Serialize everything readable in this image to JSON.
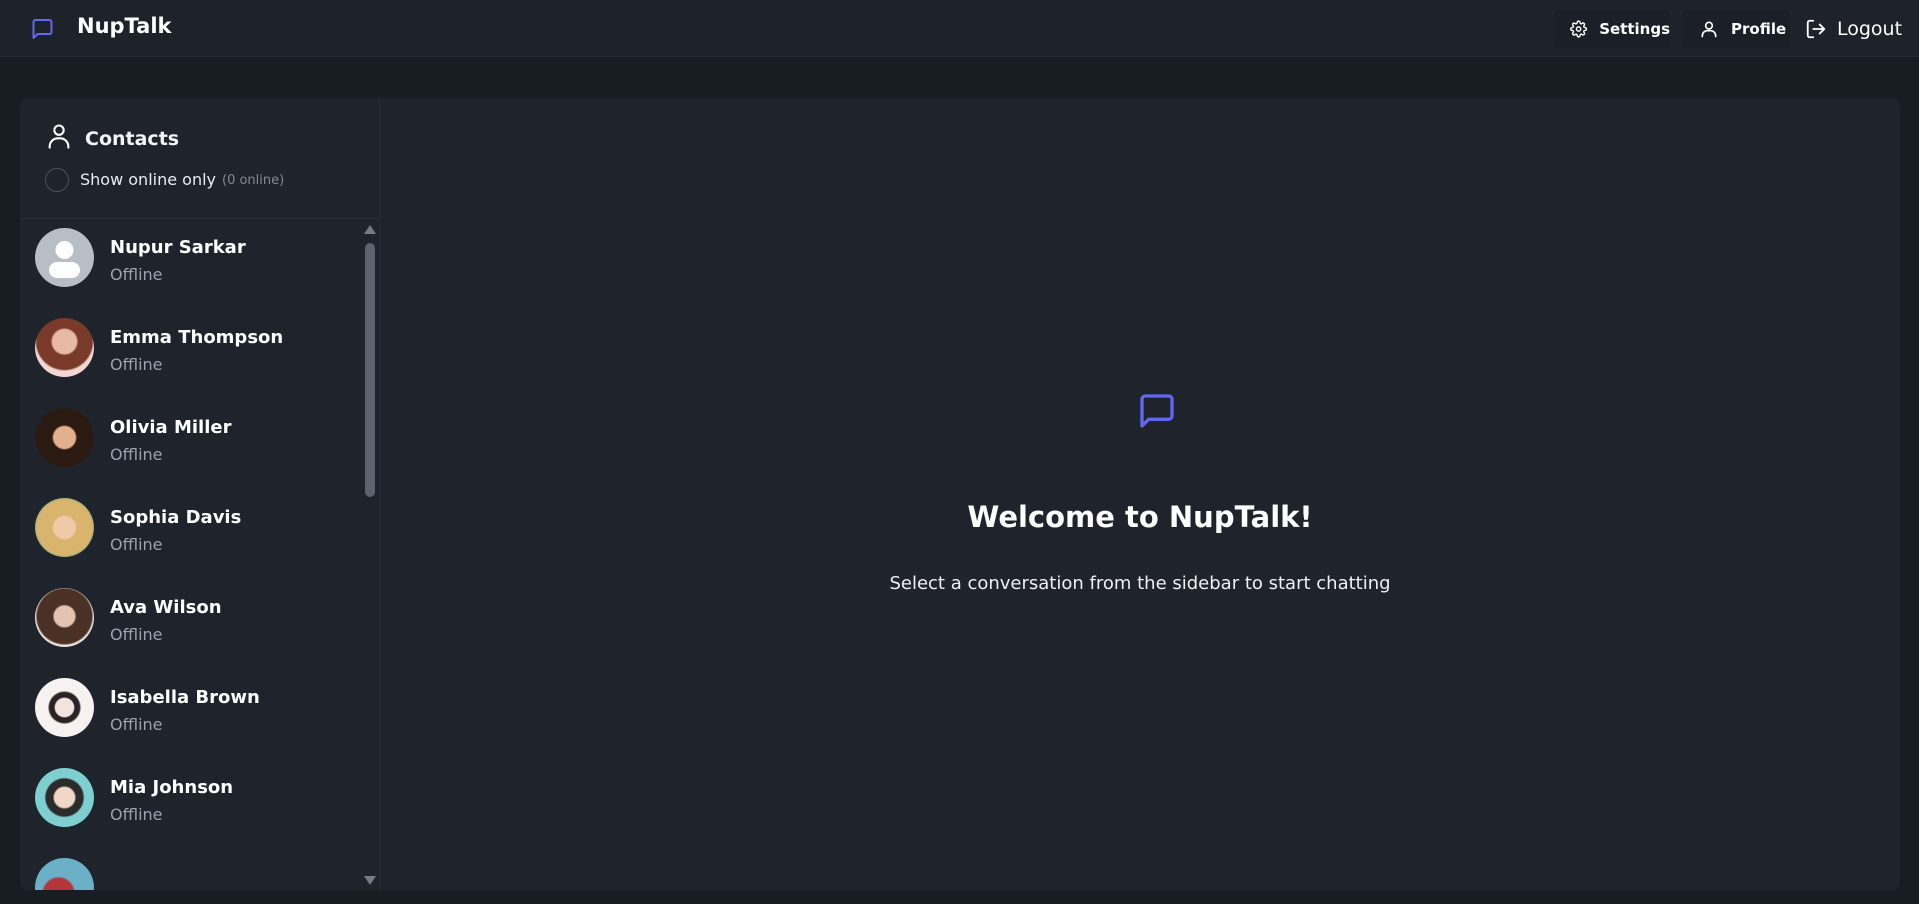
{
  "app": {
    "name": "NupTalk",
    "accent_color": "#6366f1"
  },
  "nav": {
    "settings_label": "Settings",
    "profile_label": "Profile",
    "logout_label": "Logout"
  },
  "sidebar": {
    "title": "Contacts",
    "filter_label": "Show online only",
    "online_count": "(0 online)",
    "filter_checked": false,
    "contacts": [
      {
        "name": "Nupur Sarkar",
        "status": "Offline",
        "avatar": "default-avatar"
      },
      {
        "name": "Emma Thompson",
        "status": "Offline",
        "avatar": "photo"
      },
      {
        "name": "Olivia Miller",
        "status": "Offline",
        "avatar": "photo"
      },
      {
        "name": "Sophia Davis",
        "status": "Offline",
        "avatar": "photo"
      },
      {
        "name": "Ava Wilson",
        "status": "Offline",
        "avatar": "photo"
      },
      {
        "name": "Isabella Brown",
        "status": "Offline",
        "avatar": "photo"
      },
      {
        "name": "Mia Johnson",
        "status": "Offline",
        "avatar": "photo"
      }
    ]
  },
  "welcome": {
    "title": "Welcome to NupTalk!",
    "subtitle": "Select a conversation from the sidebar to start chatting"
  }
}
